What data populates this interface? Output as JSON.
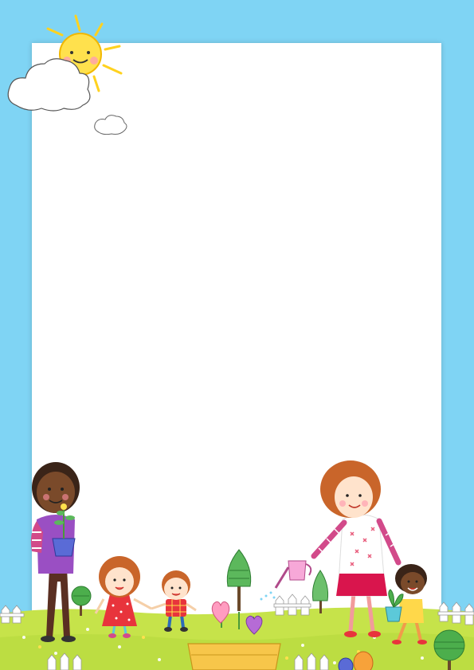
{
  "colors": {
    "sky": "#7fd4f4",
    "paper": "#ffffff",
    "grass": "#c6e34a",
    "sun": "#ffe14d",
    "fence": "#ffffff"
  },
  "icons": [
    "sun-icon",
    "cloud-icon",
    "tree-icon",
    "heart-flower-icon",
    "watering-can-icon",
    "potted-plant-icon"
  ]
}
